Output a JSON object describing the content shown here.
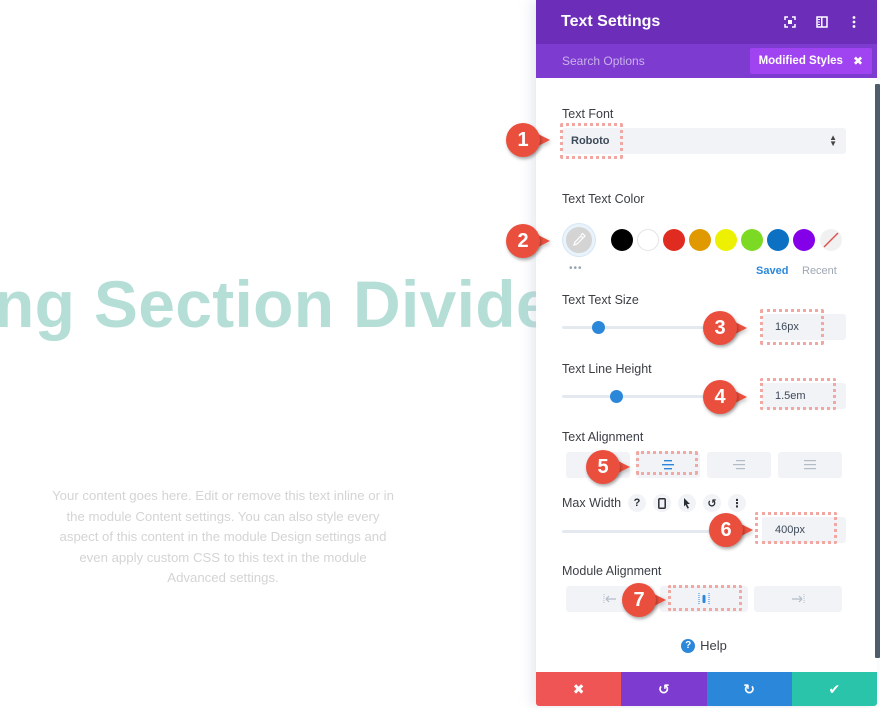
{
  "page": {
    "heading": "ng Section Divide",
    "body_text": "Your content goes here. Edit or remove this text inline or in the module Content settings. You can also style every aspect of this content in the module Design settings and even apply custom CSS to this text in the module Advanced settings."
  },
  "panel": {
    "title": "Text Settings",
    "header_icons": [
      "fullscreen-icon",
      "split-view-icon",
      "more-options-icon"
    ],
    "tabs": {
      "search_placeholder": "Search Options",
      "modified_styles": "Modified Styles",
      "modified_styles_close": "✖"
    },
    "text_font": {
      "label": "Text Font",
      "value": "Roboto"
    },
    "text_color": {
      "label": "Text Text Color",
      "swatches": [
        "#000000",
        "#ffffff",
        "#e02b20",
        "#e09900",
        "#edf000",
        "#7cda24",
        "#0c71c3",
        "#8300e9"
      ],
      "more": "•••",
      "saved": "Saved",
      "recent": "Recent"
    },
    "text_size": {
      "label": "Text Text Size",
      "value": "16px",
      "slider_fraction": 0.2
    },
    "line_height": {
      "label": "Text Line Height",
      "value": "1.5em",
      "slider_fraction": 0.3
    },
    "text_alignment": {
      "label": "Text Alignment",
      "options": [
        "left",
        "center",
        "right",
        "justify"
      ],
      "selected": "center"
    },
    "max_width": {
      "label": "Max Width",
      "icons": [
        "help-icon",
        "device-icon",
        "hover-icon",
        "reset-icon",
        "more-icon"
      ],
      "value": "400px"
    },
    "module_alignment": {
      "label": "Module Alignment",
      "options": [
        "left",
        "center",
        "right"
      ],
      "selected": "center"
    },
    "help": "Help",
    "footer": {
      "cancel": "✖",
      "undo": "↺",
      "redo": "↻",
      "save": "✔",
      "colors": {
        "cancel": "#ef5555",
        "undo": "#7e3bd0",
        "redo": "#2b87da",
        "save": "#29c4a9"
      }
    }
  },
  "annotations": [
    "1",
    "2",
    "3",
    "4",
    "5",
    "6",
    "7"
  ],
  "colors": {
    "header": "#6c2eb9",
    "tabs": "#7e3bd0",
    "modified": "#a044f1",
    "accent": "#2b87da",
    "badge": "#ea4f3e"
  }
}
